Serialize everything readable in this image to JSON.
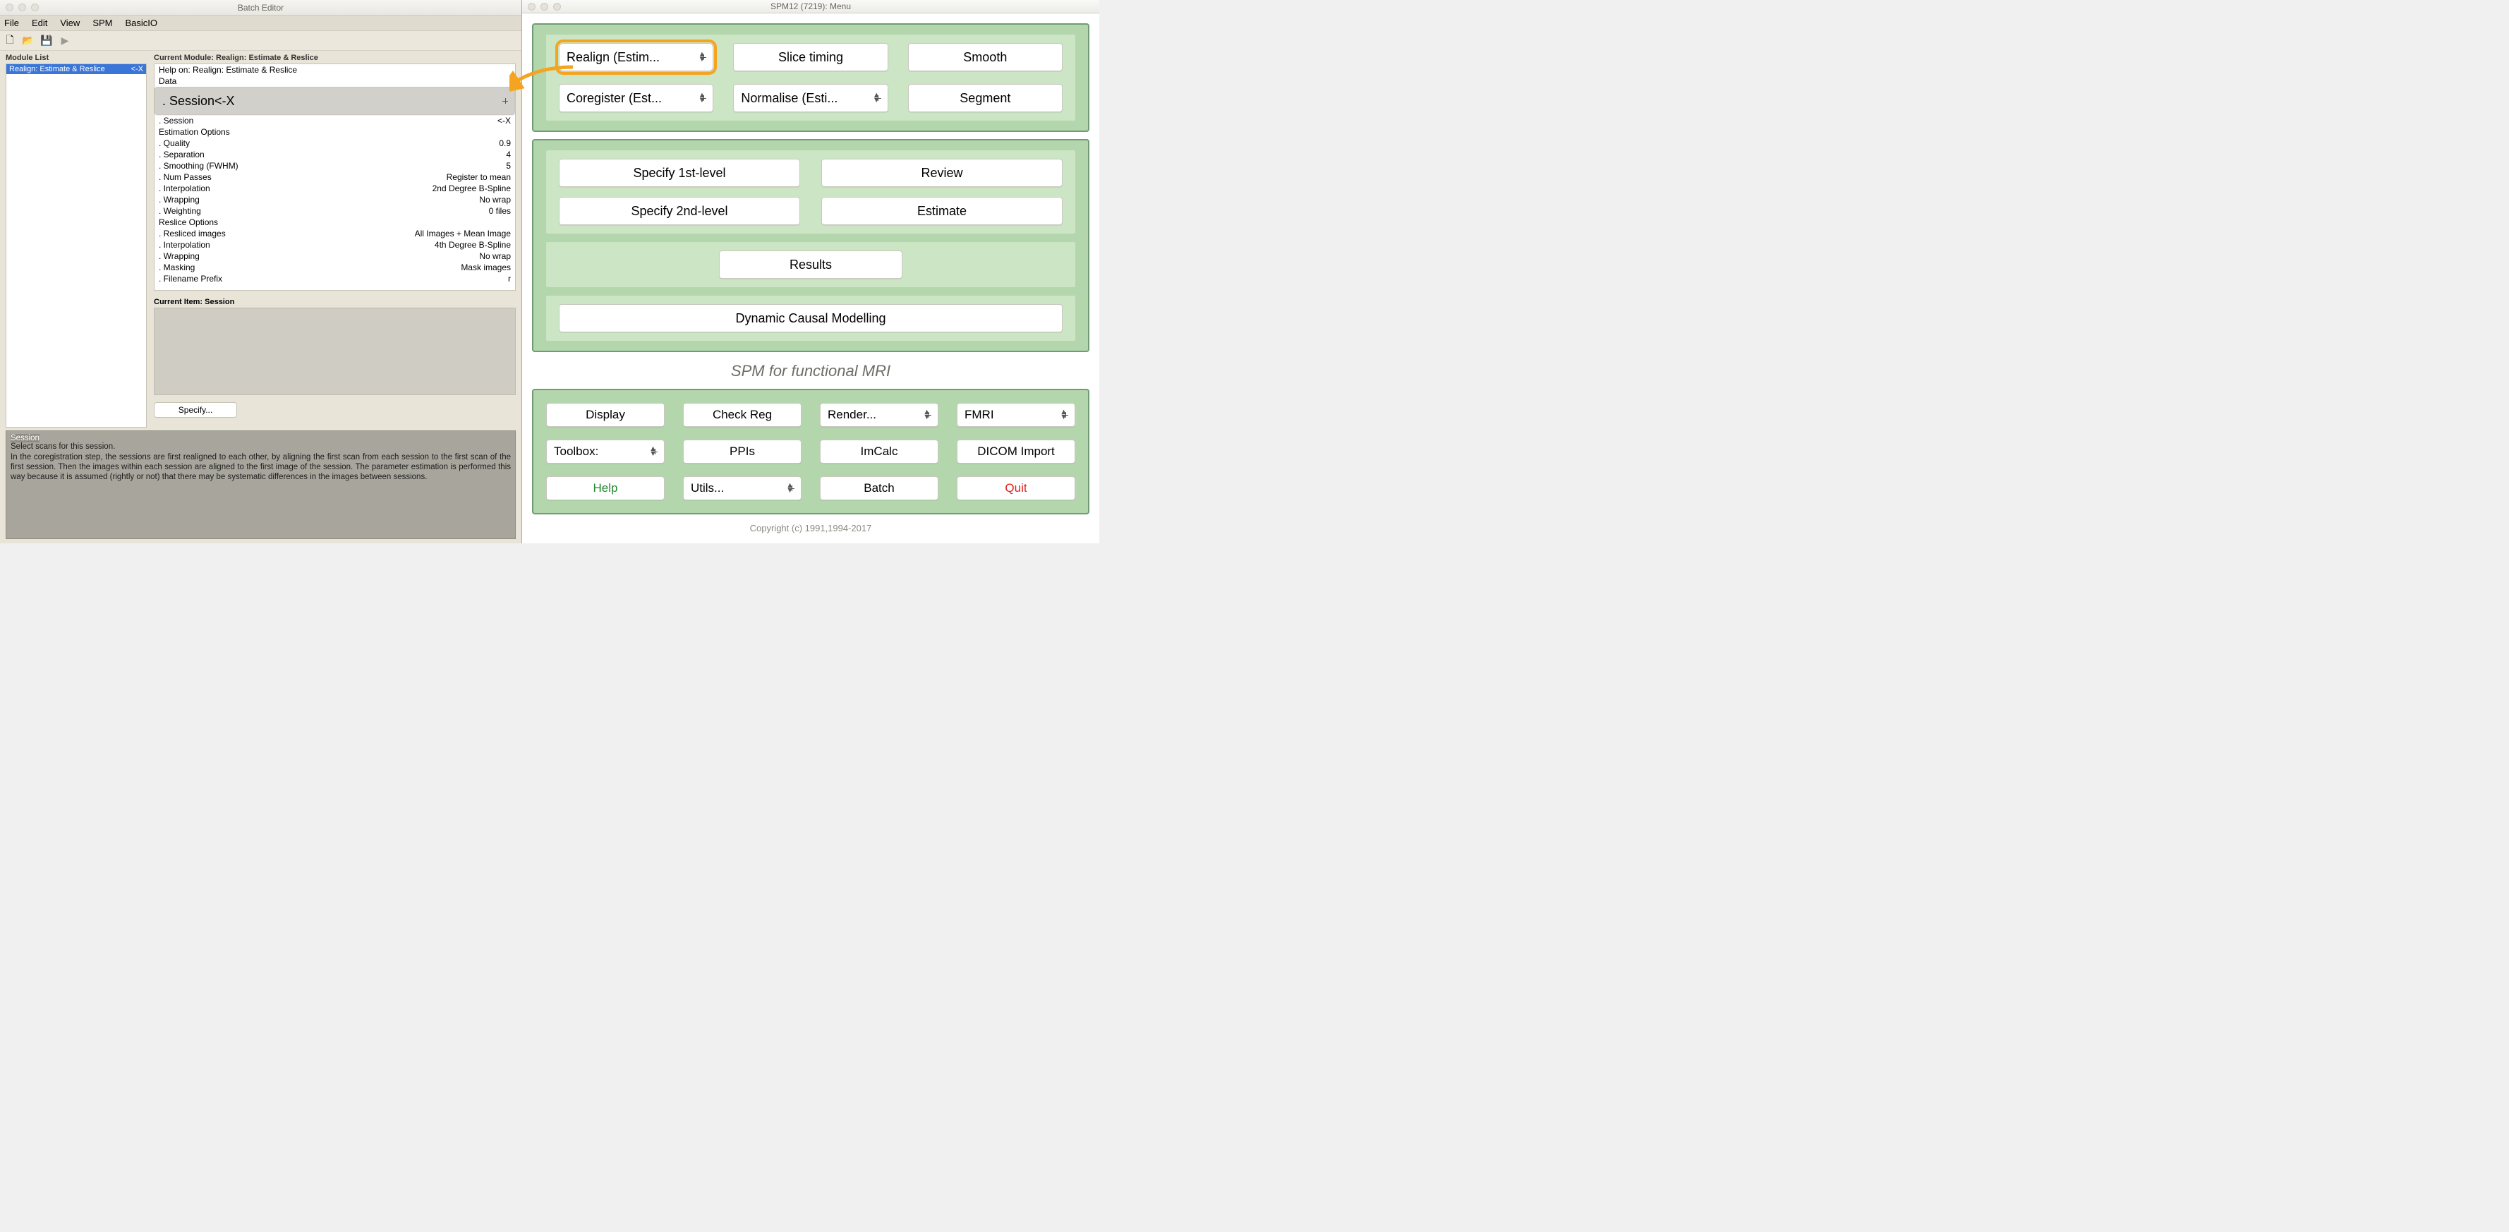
{
  "batch": {
    "title": "Batch Editor",
    "menu": [
      "File",
      "Edit",
      "View",
      "SPM",
      "BasicIO"
    ],
    "module_list_label": "Module List",
    "module_item": {
      "name": "Realign: Estimate & Reslice",
      "mark": "<-X"
    },
    "current_module_label": "Current Module: Realign: Estimate & Reslice",
    "params": [
      {
        "l": "Help on: Realign: Estimate & Reslice",
        "r": ""
      },
      {
        "l": "Data",
        "r": ""
      },
      {
        "l": ". Session",
        "r": "<-X",
        "sel": true
      },
      {
        "l": ". Session",
        "r": "<-X"
      },
      {
        "l": "Estimation Options",
        "r": ""
      },
      {
        "l": ". Quality",
        "r": "0.9"
      },
      {
        "l": ". Separation",
        "r": "4"
      },
      {
        "l": ". Smoothing (FWHM)",
        "r": "5"
      },
      {
        "l": ". Num Passes",
        "r": "Register to mean"
      },
      {
        "l": ". Interpolation",
        "r": "2nd Degree B-Spline"
      },
      {
        "l": ". Wrapping",
        "r": "No wrap"
      },
      {
        "l": ". Weighting",
        "r": "0 files"
      },
      {
        "l": "Reslice Options",
        "r": ""
      },
      {
        "l": ". Resliced images",
        "r": "All Images + Mean Image"
      },
      {
        "l": ". Interpolation",
        "r": "4th Degree B-Spline"
      },
      {
        "l": ". Wrapping",
        "r": "No wrap"
      },
      {
        "l": ". Masking",
        "r": "Mask images"
      },
      {
        "l": ". Filename Prefix",
        "r": "r"
      }
    ],
    "current_item_label": "Current Item: Session",
    "specify_label": "Specify...",
    "help": {
      "h1": "Session",
      "h2": "Select scans for this session.",
      "body": "In the coregistration step, the sessions are first realigned to each other, by aligning the first scan from each session to the first scan of the first session.  Then the images within each session are aligned to the first image of the session. The parameter estimation is performed this way because it is assumed (rightly or not) that there may be systematic differences in the images between sessions."
    }
  },
  "spm": {
    "title": "SPM12 (7219): Menu",
    "spatial": {
      "realign": "Realign (Estim...",
      "slice": "Slice timing",
      "smooth": "Smooth",
      "coreg": "Coregister (Est...",
      "norm": "Normalise (Esti...",
      "segment": "Segment"
    },
    "stats": {
      "s1": "Specify 1st-level",
      "rev": "Review",
      "s2": "Specify 2nd-level",
      "est": "Estimate",
      "results": "Results",
      "dcm": "Dynamic Causal Modelling"
    },
    "tagline": "SPM for functional MRI",
    "util": {
      "display": "Display",
      "checkreg": "Check Reg",
      "render": "Render...",
      "fmri": "FMRI",
      "toolbox": "Toolbox:",
      "ppis": "PPIs",
      "imcalc": "ImCalc",
      "dicom": "DICOM Import",
      "help": "Help",
      "utils": "Utils...",
      "batch": "Batch",
      "quit": "Quit"
    },
    "copyright": "Copyright (c) 1991,1994-2017"
  }
}
